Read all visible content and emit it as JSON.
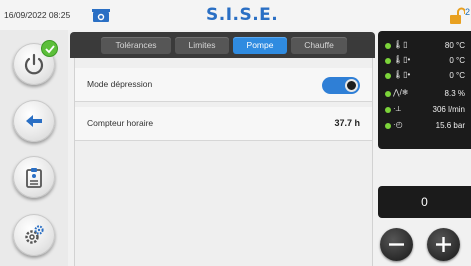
{
  "header": {
    "datetime": "16/09/2022 08:25",
    "brand": "S.I.S.E.",
    "lock_number": "2",
    "camera_icon": "camera-icon",
    "lock_icon": "unlock-icon"
  },
  "sidebar": {
    "buttons": [
      {
        "icon": "power-icon",
        "badge": "check-icon"
      },
      {
        "icon": "back-arrow-icon"
      },
      {
        "icon": "clipboard-icon"
      },
      {
        "icon": "settings-gears-icon"
      }
    ]
  },
  "tabs": [
    {
      "label": "Tolérances",
      "active": false
    },
    {
      "label": "Limites",
      "active": false
    },
    {
      "label": "Pompe",
      "active": true
    },
    {
      "label": "Chauffe",
      "active": false
    }
  ],
  "settings": {
    "mode_depression_label": "Mode dépression",
    "mode_depression_on": true,
    "compteur_label": "Compteur horaire",
    "compteur_value": "37.7 h"
  },
  "status": [
    {
      "icon": "temperature-icon",
      "value": "80 °C"
    },
    {
      "icon": "temperature-in-icon",
      "value": "0 °C"
    },
    {
      "icon": "temperature-out-icon",
      "value": "0 °C"
    },
    {
      "icon": "hot-cold-icon",
      "value": "8.3 %"
    },
    {
      "icon": "flow-icon",
      "value": "306 l/min"
    },
    {
      "icon": "pressure-gauge-icon",
      "value": "15.6 bar"
    }
  ],
  "numeric": {
    "value": "0"
  },
  "colors": {
    "accent": "#2f8be0",
    "brand": "#2a6fc4",
    "status_ok": "#7cd43a",
    "badge_green": "#5cbf3a"
  }
}
